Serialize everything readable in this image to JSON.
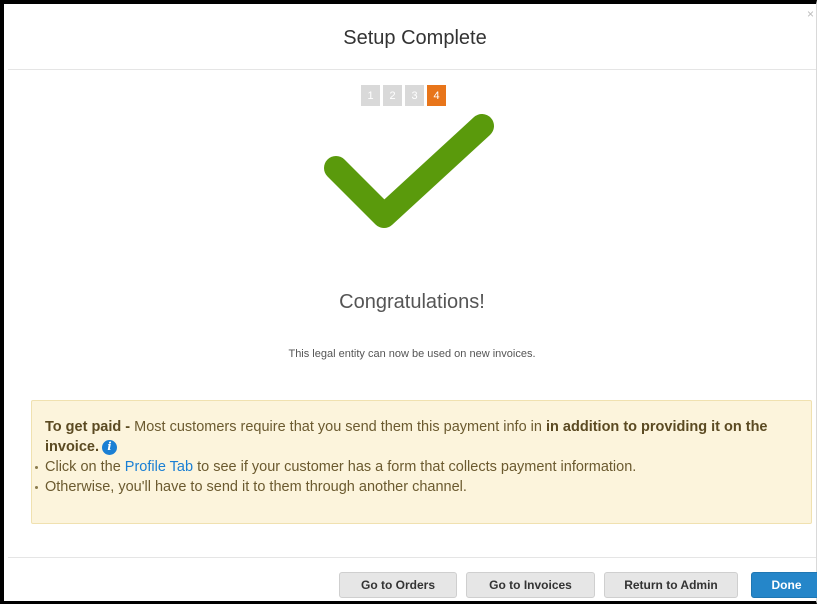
{
  "dialog": {
    "title": "Setup Complete",
    "close_glyph": "×"
  },
  "wizard": {
    "steps": [
      "1",
      "2",
      "3",
      "4"
    ],
    "active_step": 4,
    "active_color": "#e8751a",
    "inactive_color": "#d9d9d9"
  },
  "success": {
    "icon": "checkmark-icon",
    "icon_color": "#5a9a0c",
    "heading": "Congratulations!",
    "message": "This legal entity can now be used on new invoices."
  },
  "notice": {
    "lead_bold": "To get paid -",
    "lead_text": " Most customers require that you send them this payment info in ",
    "lead_bold2": "in addition to providing it on the invoice.",
    "info_icon": "info-icon",
    "bullet1_before": "Click on the ",
    "bullet1_link": "Profile Tab",
    "bullet1_after": " to see if your customer has a form that collects payment information.",
    "bullet2": "Otherwise, you'll have to send it to them through another channel."
  },
  "footer": {
    "buttons": [
      "Go to Orders",
      "Go to Invoices",
      "Return to Admin",
      "Done"
    ]
  }
}
